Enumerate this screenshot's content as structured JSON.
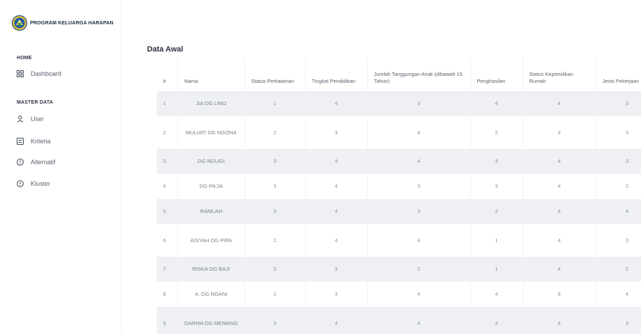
{
  "brand": {
    "title": "PROGRAM KELUARGA HARAPAN",
    "logo_icon": "pkh-logo-emblem"
  },
  "sidebar": {
    "sections": [
      {
        "title": "HOME",
        "items": [
          {
            "label": "Dashboard",
            "icon": "grid-icon"
          }
        ]
      },
      {
        "title": "MASTER DATA",
        "items": [
          {
            "label": "User",
            "icon": "user-icon"
          },
          {
            "label": "Kriteria",
            "icon": "list-icon"
          },
          {
            "label": "Alternatif",
            "icon": "alert-circle-icon"
          },
          {
            "label": "Kluster",
            "icon": "alert-circle-icon"
          }
        ]
      }
    ]
  },
  "main": {
    "title": "Data Awal",
    "table": {
      "headers": [
        "#",
        "Nama",
        "Status Perkawinan",
        "Tingkat Pendidikan",
        "Jumlah Tanggungan Anak (dibawah 15 Tahun)",
        "Penghasilan",
        "Status Kepemilikan Rumah",
        "Jenis Pekerjaan"
      ],
      "rows": [
        [
          "1",
          "JIA DG LINO",
          "1",
          "4",
          "3",
          "4",
          "4",
          "3"
        ],
        [
          "2",
          "MULIATI DG NGONA",
          "2",
          "3",
          "4",
          "2",
          "4",
          "3"
        ],
        [
          "3",
          "DG NGUGI",
          "3",
          "4",
          "4",
          "3",
          "4",
          "3"
        ],
        [
          "4",
          "DG PA'JA",
          "3",
          "4",
          "3",
          "3",
          "4",
          "2"
        ],
        [
          "5",
          "RAMLAH",
          "3",
          "4",
          "3",
          "2",
          "4",
          "4"
        ],
        [
          "6",
          "AISYAH DG PIPA",
          "2",
          "4",
          "4",
          "1",
          "4",
          "3"
        ],
        [
          "7",
          "RISKA DG BAJI",
          "3",
          "3",
          "2",
          "1",
          "4",
          "2"
        ],
        [
          "8",
          "A. DG NGANI",
          "1",
          "3",
          "4",
          "4",
          "3",
          "4"
        ],
        [
          "9",
          "DARMA DG MEMANG",
          "3",
          "4",
          "4",
          "4",
          "4",
          "3"
        ]
      ]
    }
  }
}
